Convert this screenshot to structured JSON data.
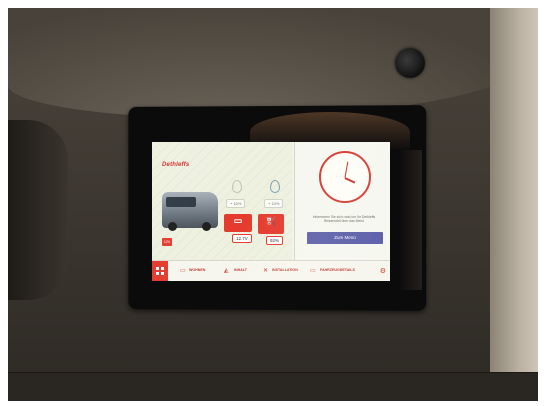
{
  "display": {
    "brand": "Dethleffs",
    "tanks": {
      "fresh_water_label": "+ 10%",
      "grey_water_label": "+ 10%"
    },
    "battery_value": "12.7V",
    "gas_value": "92%",
    "voltage_badge": "12V",
    "info_text": "Informieren Sie sich rund um Ihr Dethleffs Reisemobil über das Menü",
    "menu_button": "Zum Menü",
    "nav": {
      "item1": "WOHNEN",
      "item2": "INHALT",
      "item3": "INSTALLATION",
      "item4": "FAHRZEUGDETAILS"
    }
  },
  "colors": {
    "accent": "#e43a2e",
    "menu_button": "#5c5fa8"
  }
}
